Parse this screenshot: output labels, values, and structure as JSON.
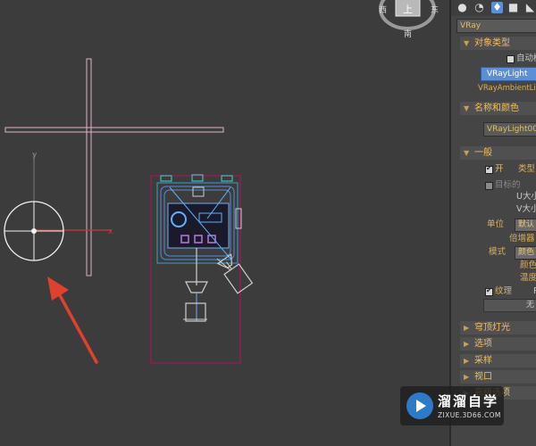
{
  "viewcube": {
    "face_label": "上",
    "compass_top": "北",
    "compass_left": "西",
    "compass_right": "东",
    "compass_bottom": "南"
  },
  "axis": {
    "x_label": "x",
    "y_label": "y"
  },
  "annotation": {
    "arrow_color": "#e0412e"
  },
  "panel": {
    "toolbar_icons": [
      "geometry-icon",
      "shapes-icon",
      "lights-icon",
      "cameras-icon",
      "helpers-icon"
    ],
    "category_dropdown": "VRay",
    "object_type": {
      "header": "对象类型",
      "autogrid_label": "自动栅格",
      "vraylight_button": "VRayLight",
      "ambient_button": "VRayAmbientLight"
    },
    "name_color": {
      "header": "名称和颜色",
      "name_value": "VRayLight001"
    },
    "general": {
      "header": "一般",
      "on_label": "开",
      "type_label": "类型",
      "targeted_label": "目标的",
      "u_size_label": "U大小",
      "v_size_label": "V大小",
      "units_label": "单位",
      "units_value": "默认",
      "multiplier_label": "倍增器",
      "mode_label": "模式",
      "mode_value": "颜色",
      "color_label": "颜色",
      "temperature_label": "温度",
      "texture_label": "纹理",
      "texture_res_label": "R",
      "texture_slot": "无"
    },
    "rollouts": [
      "穹顶灯光",
      "选项",
      "采样",
      "视口",
      "高级选项"
    ]
  },
  "watermark": {
    "title": "溜溜自学",
    "subtitle": "ZIXUE.3D66.COM",
    "brand_color": "#2c7ac8"
  }
}
